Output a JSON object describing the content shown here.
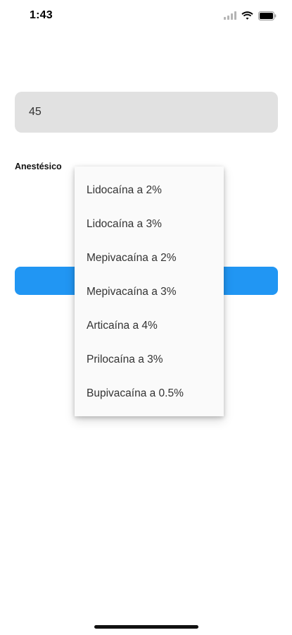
{
  "status_bar": {
    "time": "1:43",
    "icons": [
      "cellular-signal-icon",
      "wifi-icon",
      "battery-icon"
    ]
  },
  "form": {
    "value_field": "45",
    "anesthetic_label": "Anestésico",
    "button_color": "#2196f3"
  },
  "dropdown": {
    "options": [
      "Lidocaína a 2%",
      "Lidocaína a 3%",
      "Mepivacaína a 2%",
      "Mepivacaína a 3%",
      "Articaína a 4%",
      "Prilocaína a 3%",
      "Bupivacaína a 0.5%"
    ]
  }
}
